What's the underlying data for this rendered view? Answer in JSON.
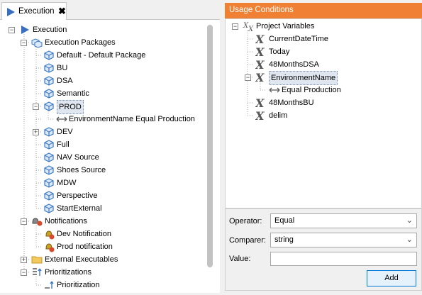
{
  "left_tab": {
    "title": "Execution",
    "close": "✖"
  },
  "left_tree": [
    {
      "label": "Execution",
      "icon": "execution-play-icon",
      "expanded": true
    },
    {
      "label": "Execution Packages",
      "icon": "packages-icon",
      "expanded": true
    },
    {
      "label": "Default - Default Package",
      "icon": "package-icon"
    },
    {
      "label": "BU",
      "icon": "package-icon"
    },
    {
      "label": "DSA",
      "icon": "package-icon"
    },
    {
      "label": "Semantic",
      "icon": "package-icon"
    },
    {
      "label": "PROD",
      "icon": "package-icon",
      "expanded": true,
      "selected": true
    },
    {
      "label": "EnvironmentName Equal Production",
      "icon": "condition-arrow-icon"
    },
    {
      "label": "DEV",
      "icon": "package-icon",
      "expanded": false
    },
    {
      "label": "Full",
      "icon": "package-icon"
    },
    {
      "label": "NAV Source",
      "icon": "package-icon"
    },
    {
      "label": "Shoes Source",
      "icon": "package-icon"
    },
    {
      "label": "MDW",
      "icon": "package-icon"
    },
    {
      "label": "Perspective",
      "icon": "package-icon"
    },
    {
      "label": "StartExternal",
      "icon": "package-icon"
    },
    {
      "label": "Notifications",
      "icon": "notifications-icon",
      "expanded": true
    },
    {
      "label": "Dev Notification",
      "icon": "notification-bell-icon"
    },
    {
      "label": "Prod notification",
      "icon": "notification-bell-icon"
    },
    {
      "label": "External Executables",
      "icon": "folder-icon",
      "expanded": false
    },
    {
      "label": "Prioritizations",
      "icon": "prioritizations-icon",
      "expanded": true
    },
    {
      "label": "Prioritization",
      "icon": "prioritization-icon"
    }
  ],
  "usage": {
    "header": "Usage Conditions",
    "tree": [
      {
        "label": "Project Variables",
        "icon": "variables-icon"
      },
      {
        "label": "CurrentDateTime",
        "icon": "variable-x-icon"
      },
      {
        "label": "Today",
        "icon": "variable-x-icon"
      },
      {
        "label": "48MonthsDSA",
        "icon": "variable-x-icon"
      },
      {
        "label": "EnvironmentName",
        "icon": "variable-x-icon",
        "selected": true
      },
      {
        "label": "Equal Production",
        "icon": "condition-arrow-icon"
      },
      {
        "label": "48MonthsBU",
        "icon": "variable-x-icon"
      },
      {
        "label": "delim",
        "icon": "variable-x-icon"
      }
    ],
    "form": {
      "operator_label": "Operator:",
      "operator_value": "Equal",
      "comparer_label": "Comparer:",
      "comparer_value": "string",
      "value_label": "Value:",
      "value_text": "",
      "add_label": "Add"
    }
  },
  "glyphs": {
    "chevron": "⌄",
    "x_var": "X",
    "arrow": "↔",
    "minus": "−",
    "plus": "+"
  },
  "colors": {
    "header_orange": "#f08033",
    "play_blue": "#3a6fbf",
    "icon_blue": "#3b78c3"
  }
}
